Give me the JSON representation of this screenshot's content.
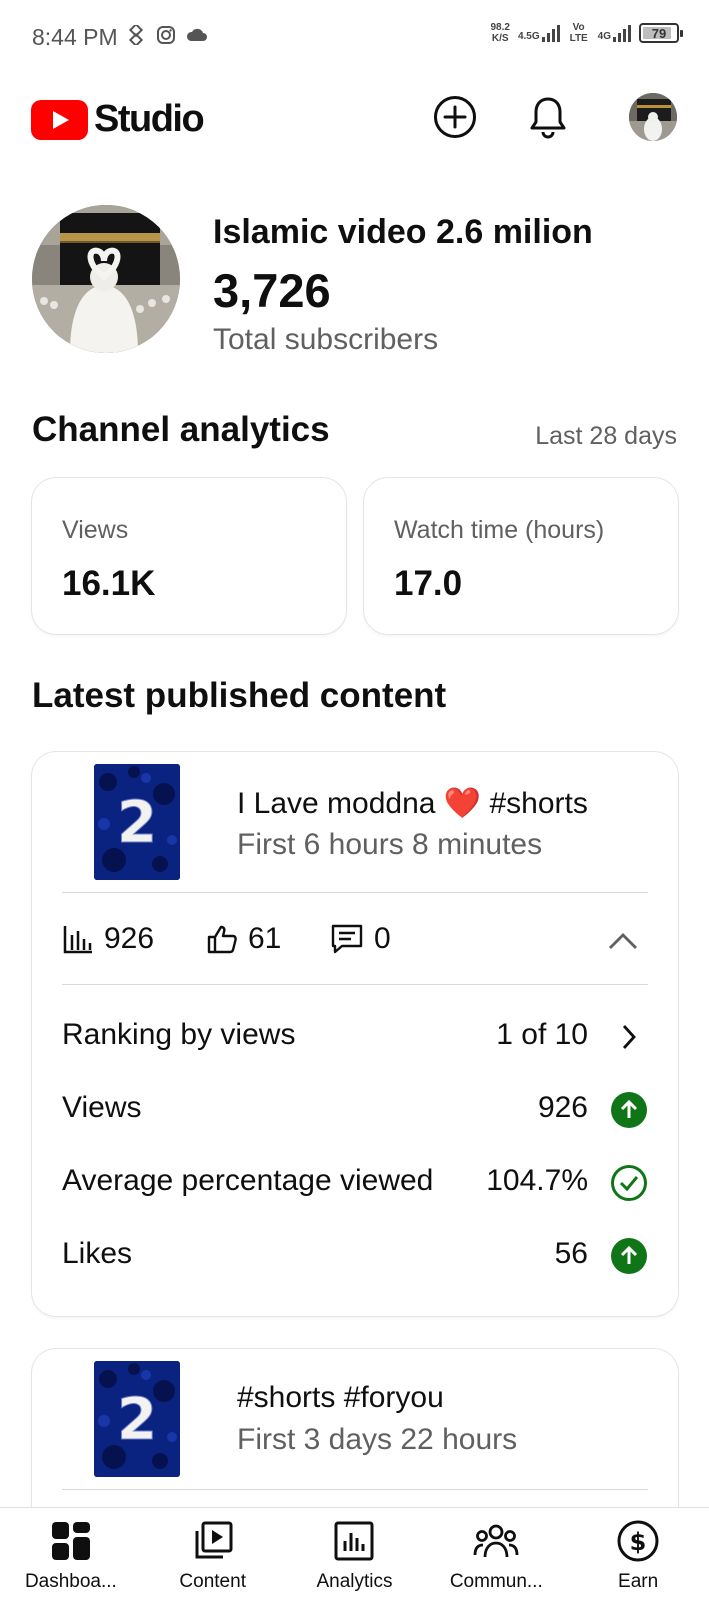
{
  "status_bar": {
    "time": "8:44 PM",
    "net_speed_value": "98.2",
    "net_speed_unit": "K/S",
    "signal_1_label": "4.5G",
    "volte_label": "Vo LTE",
    "signal_2_label": "4G",
    "battery_level": "79"
  },
  "header": {
    "brand": "Studio"
  },
  "channel": {
    "name": "Islamic video 2.6 milion",
    "subscriber_count": "3,726",
    "subscriber_label": "Total subscribers"
  },
  "analytics": {
    "title": "Channel analytics",
    "period": "Last 28 days",
    "cards": [
      {
        "label": "Views",
        "value": "16.1K"
      },
      {
        "label": "Watch time (hours)",
        "value": "17.0"
      }
    ]
  },
  "latest": {
    "title": "Latest published content",
    "items": [
      {
        "title": "I Lave moddna ❤️ #shorts",
        "subtitle": "First 6 hours 8 minutes",
        "thumb_text": "2",
        "views": "926",
        "likes": "61",
        "comments": "0",
        "rows": [
          {
            "label": "Ranking by views",
            "value": "1 of 10",
            "icon": "chevron-right-icon"
          },
          {
            "label": "Views",
            "value": "926",
            "icon": "arrow-up-circle-icon"
          },
          {
            "label": "Average percentage viewed",
            "value": "104.7%",
            "icon": "check-circle-icon"
          },
          {
            "label": "Likes",
            "value": "56",
            "icon": "arrow-up-circle-icon"
          }
        ]
      },
      {
        "title": "#shorts #foryou",
        "subtitle": "First 3 days 22 hours",
        "thumb_text": "2"
      }
    ]
  },
  "nav": {
    "items": [
      {
        "label": "Dashboa...",
        "icon": "dashboard-icon"
      },
      {
        "label": "Content",
        "icon": "content-icon"
      },
      {
        "label": "Analytics",
        "icon": "analytics-icon"
      },
      {
        "label": "Commun...",
        "icon": "community-icon"
      },
      {
        "label": "Earn",
        "icon": "earn-icon"
      }
    ]
  },
  "colors": {
    "brand_red": "#ff0000",
    "success_green": "#107516",
    "text_primary": "#0f0f0f",
    "text_secondary": "#606060"
  }
}
